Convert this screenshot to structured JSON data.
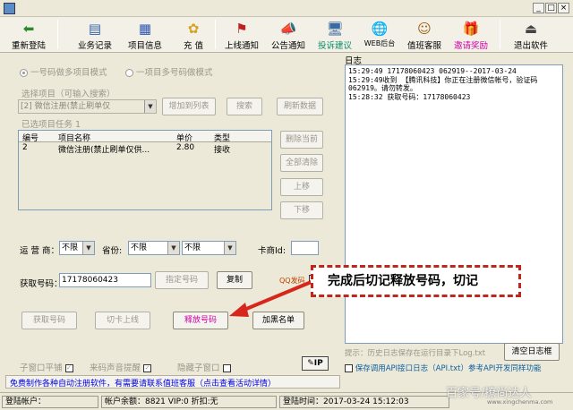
{
  "window": {
    "controls": [
      "_",
      "□",
      "×"
    ]
  },
  "toolbar": {
    "buttons": [
      {
        "label": "重新登陆",
        "icon": "back-arrow-icon",
        "glyph": "⬅"
      },
      {
        "label": "业务记录",
        "icon": "folder-icon",
        "glyph": "▤"
      },
      {
        "label": "项目信息",
        "icon": "grid-icon",
        "glyph": "▦"
      },
      {
        "label": "充 值",
        "icon": "coins-icon",
        "glyph": "✿"
      },
      {
        "label": "上线通知",
        "icon": "flag-icon",
        "glyph": "⚑"
      },
      {
        "label": "公告通知",
        "icon": "megaphone-icon",
        "glyph": "📣"
      },
      {
        "label": "投诉建议",
        "icon": "monitor-icon",
        "glyph": "🖥"
      },
      {
        "label": "WEB后台",
        "icon": "web-icon",
        "glyph": "🌐"
      },
      {
        "label": "值班客服",
        "icon": "support-icon",
        "glyph": "☺"
      },
      {
        "label": "邀请奖励",
        "icon": "gift-icon",
        "glyph": "🎁"
      },
      {
        "label": "退出软件",
        "icon": "exit-icon",
        "glyph": "⏏"
      }
    ]
  },
  "mode": {
    "option1": "一号码做多项目模式",
    "option2": "一项目多号码做模式"
  },
  "project": {
    "select_label": "选择项目（可输入搜索）",
    "select_value": "[2]       微信注册(禁止刷单仅",
    "add_button": "增加到列表",
    "search_button": "搜索",
    "refresh_button": "刷新数据",
    "selected_count": "已选项目任务 1"
  },
  "table": {
    "headers": [
      "编号",
      "项目名称",
      "单价",
      "类型"
    ],
    "rows": [
      [
        "2",
        "微信注册(禁止刷单仅供...",
        "2.80",
        "接收"
      ]
    ]
  },
  "side_buttons": {
    "delete": "删除当前",
    "clear": "全部清除",
    "up": "上移",
    "down": "下移"
  },
  "filters": {
    "carrier_label": "运 营 商：",
    "carrier_value": "不限",
    "province_label": "省份:",
    "province_value": "不限",
    "city_value": "不限",
    "merchant_label": "卡商Id:",
    "merchant_value": ""
  },
  "number": {
    "label": "获取号码：",
    "value": "17178060423",
    "assign_button": "指定号码",
    "copy_button": "复制",
    "qq_label": "QQ发码"
  },
  "actions": {
    "get": "获取号码",
    "switch": "切卡上线",
    "release": "释放号码",
    "blacklist": "加黑名单"
  },
  "options": {
    "tile": "子窗口平铺",
    "sound": "来码声音提醒",
    "hide": "隐藏子窗口"
  },
  "log": {
    "title": "日志",
    "content": "15:29:49 17178060423 062919--2017-03-24\n15:29:49收到 【腾讯科技】你正在注册微信帐号，验证码062919。请勿转发。\n15:28:32 获取号码：17178060423",
    "hint": "提示：历史日志保存在运行目录下Log.txt",
    "clear_button": "清空日志框",
    "save_option": "保存调用API接口日志（API.txt）参考API开发同样功能"
  },
  "notice": "免费制作各种自动注册软件，有需要请联系值班客服（点击查看活动详情）",
  "status": {
    "account_label": "登陆帐户：",
    "balance": "帐户余额：8821   VIP:0  折扣:无",
    "login_time": "登陆时间：2017-03-24 15:12:03"
  },
  "callout": "完成后切记释放号码，切记",
  "watermark": {
    "line1": "百家号/撩尚达人",
    "line2": "www.xingchenma.com"
  },
  "colors": {
    "release_text": "#d000a6",
    "notice_text": "#0000e0",
    "callout_border": "#c0271c",
    "arrow": "#d7261b"
  }
}
